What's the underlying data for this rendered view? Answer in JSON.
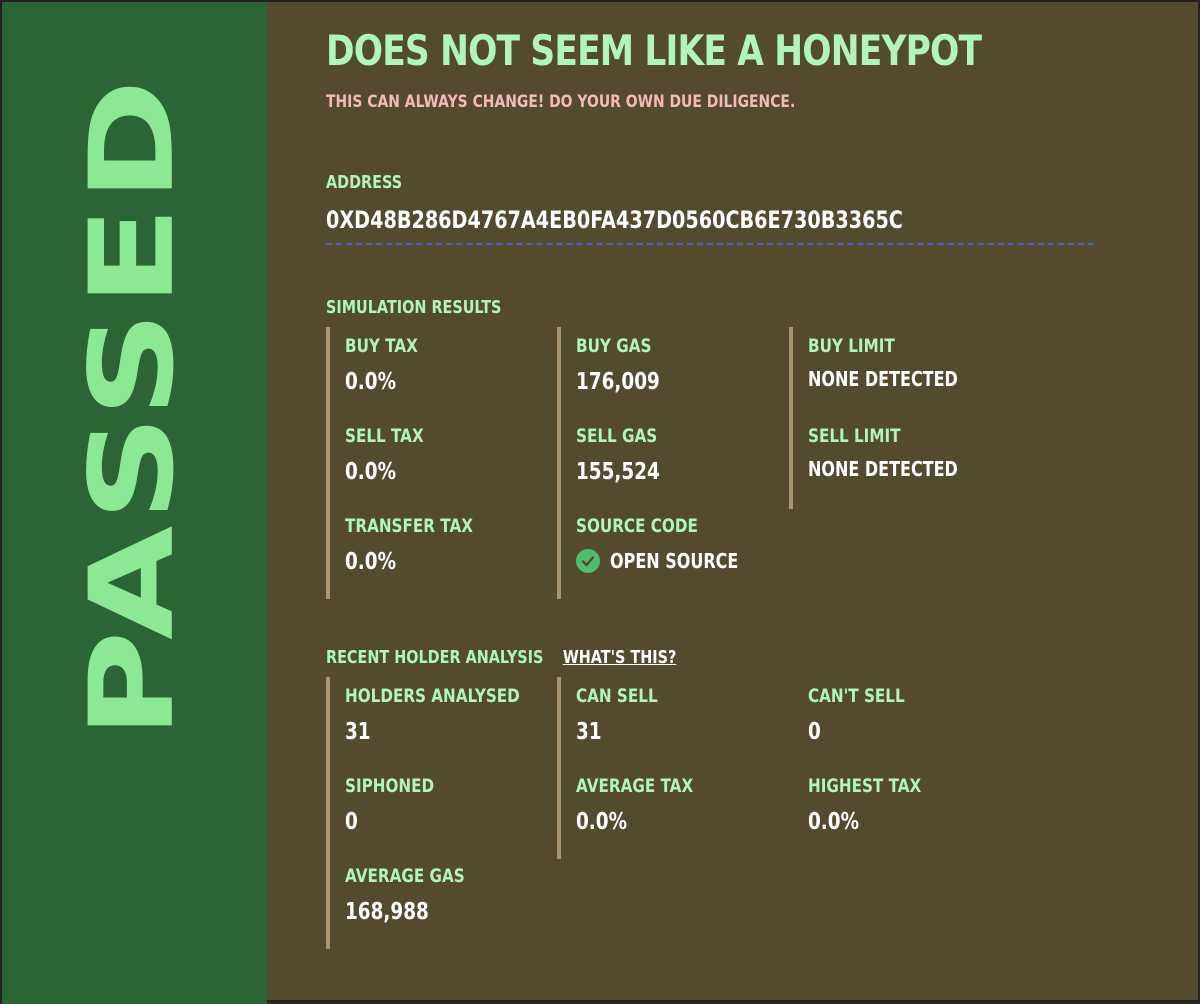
{
  "verdict": "PASSED",
  "headline": "DOES NOT SEEM LIKE A HONEYPOT",
  "warning": "THIS CAN ALWAYS CHANGE! DO YOUR OWN DUE DILIGENCE.",
  "address": {
    "label": "ADDRESS",
    "value": "0XD48B286D4767A4EB0FA437D0560CB6E730B3365C"
  },
  "simulation": {
    "title": "SIMULATION RESULTS",
    "buy_tax": {
      "label": "BUY TAX",
      "value": "0.0%"
    },
    "sell_tax": {
      "label": "SELL TAX",
      "value": "0.0%"
    },
    "transfer_tax": {
      "label": "TRANSFER TAX",
      "value": "0.0%"
    },
    "buy_gas": {
      "label": "BUY GAS",
      "value": "176,009"
    },
    "sell_gas": {
      "label": "SELL GAS",
      "value": "155,524"
    },
    "source_code": {
      "label": "SOURCE CODE",
      "value": "OPEN SOURCE",
      "icon": "check-circle-icon"
    },
    "buy_limit": {
      "label": "BUY LIMIT",
      "value": "NONE DETECTED"
    },
    "sell_limit": {
      "label": "SELL LIMIT",
      "value": "NONE DETECTED"
    }
  },
  "holders": {
    "title": "RECENT HOLDER ANALYSIS",
    "help_link": "WHAT'S THIS?",
    "holders_analysed": {
      "label": "HOLDERS ANALYSED",
      "value": "31"
    },
    "siphoned": {
      "label": "SIPHONED",
      "value": "0"
    },
    "average_gas": {
      "label": "AVERAGE GAS",
      "value": "168,988"
    },
    "can_sell": {
      "label": "CAN SELL",
      "value": "31"
    },
    "average_tax": {
      "label": "AVERAGE TAX",
      "value": "0.0%"
    },
    "cant_sell": {
      "label": "CAN'T SELL",
      "value": "0"
    },
    "highest_tax": {
      "label": "HIGHEST TAX",
      "value": "0.0%"
    }
  },
  "colors": {
    "verdict_band": "#2b6535",
    "verdict_text": "#8de895",
    "panel": "#544a2e",
    "heading": "#b0f5bb",
    "warning": "#f4b9b9",
    "divider": "#a89572",
    "address_rule": "#4a61c4",
    "check": "#4fbd6d"
  }
}
